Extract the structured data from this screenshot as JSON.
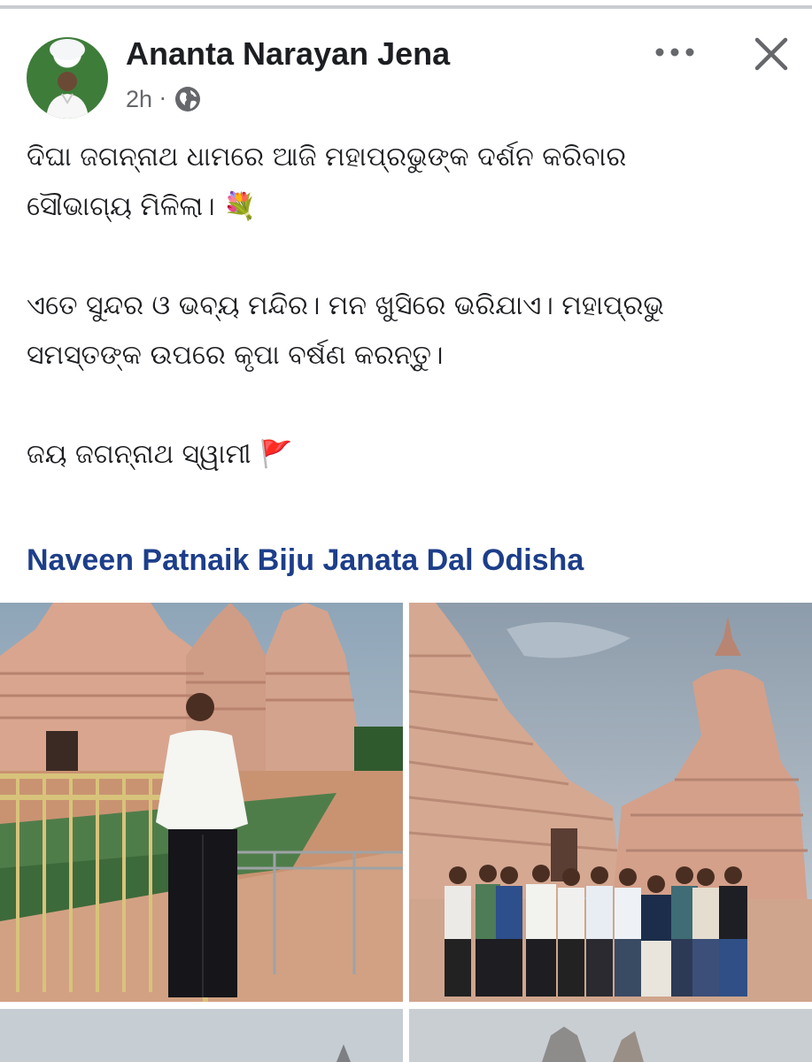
{
  "post": {
    "author_name": "Ananta Narayan Jena",
    "time": "2h",
    "separator": "·",
    "privacy_icon": "globe-icon",
    "more_icon": "more-horizontal-icon",
    "close_icon": "close-icon",
    "body": {
      "line1": "ଦିଘା ଜଗନ୍ନାଥ ଧାମରେ ଆଜି ମହାପ୍ରଭୁଙ୍କ ଦର୍ଶନ କରିବାର",
      "line2": "ସୌଭାଗ୍ୟ ମିଳିଲା। 💐",
      "line3": "ଏତେ ସୁନ୍ଦର ଓ ଭବ୍ୟ ମନ୍ଦିର। ମନ ଖୁସିରେ ଭରିଯାଏ। ମହାପ୍ରଭୁ",
      "line4": "ସମସ୍ତଙ୍କ ଉପରେ କୃପା ବର୍ଷଣ କରନ୍ତୁ।",
      "line5": "ଜୟ ଜଗନ୍ନାଥ ସ୍ୱାମୀ 🚩"
    },
    "tags": "Naveen Patnaik Biju Janata Dal Odisha"
  },
  "colors": {
    "tag_link": "#1d3e8a",
    "secondary_text": "#65676b",
    "primary_text": "#1c1e21"
  }
}
